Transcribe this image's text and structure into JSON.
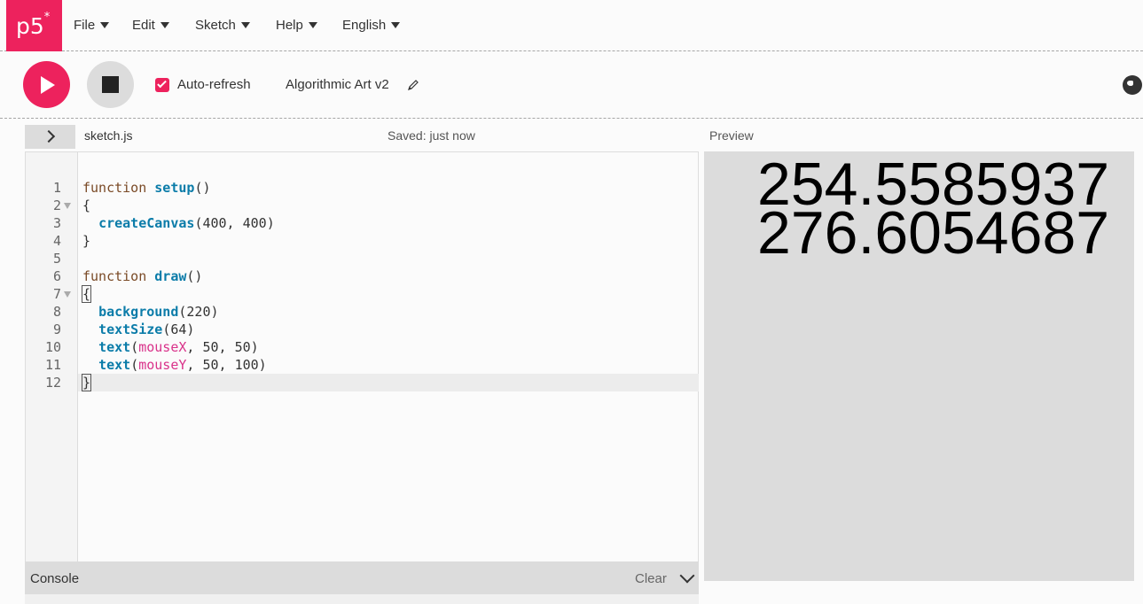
{
  "app": {
    "logo_text": "p5",
    "logo_sup": "*",
    "brand_color": "#ed225d"
  },
  "menu": [
    {
      "label": "File"
    },
    {
      "label": "Edit"
    },
    {
      "label": "Sketch"
    },
    {
      "label": "Help"
    },
    {
      "label": "English"
    }
  ],
  "toolbar": {
    "play_icon": "play-icon",
    "stop_icon": "stop-icon",
    "auto_refresh_label": "Auto-refresh",
    "auto_refresh_checked": true,
    "project_name": "Algorithmic Art v2"
  },
  "editor": {
    "file_name": "sketch.js",
    "saved_status": "Saved: just now",
    "preview_label": "Preview",
    "lines": [
      {
        "num": "1",
        "fold": false,
        "html": "<span class=\"kw\">function</span> <span class=\"fn\">setup</span>()"
      },
      {
        "num": "2",
        "fold": true,
        "html": "{"
      },
      {
        "num": "3",
        "fold": false,
        "html": "  <span class=\"fn\">createCanvas</span>(400, 400)"
      },
      {
        "num": "4",
        "fold": false,
        "html": "}"
      },
      {
        "num": "5",
        "fold": false,
        "html": ""
      },
      {
        "num": "6",
        "fold": false,
        "html": "<span class=\"kw\">function</span> <span class=\"fn\">draw</span>()"
      },
      {
        "num": "7",
        "fold": true,
        "html": "<span class=\"bracket-hl\">{</span>"
      },
      {
        "num": "8",
        "fold": false,
        "html": "  <span class=\"fn\">background</span>(220)"
      },
      {
        "num": "9",
        "fold": false,
        "html": "  <span class=\"fn\">textSize</span>(64)"
      },
      {
        "num": "10",
        "fold": false,
        "html": "  <span class=\"fn\">text</span>(<span class=\"var\">mouseX</span>, 50, 50)"
      },
      {
        "num": "11",
        "fold": false,
        "html": "  <span class=\"fn\">text</span>(<span class=\"var\">mouseY</span>, 50, 100)"
      },
      {
        "num": "12",
        "fold": false,
        "html": "<span class=\"bracket-hl\">}</span><span id=\"cursor\"></span>"
      }
    ]
  },
  "console": {
    "label": "Console",
    "clear_label": "Clear"
  },
  "preview": {
    "mouse_x_text": "254.5585937",
    "mouse_y_text": "276.6054687",
    "background": "#dcdcdc"
  }
}
